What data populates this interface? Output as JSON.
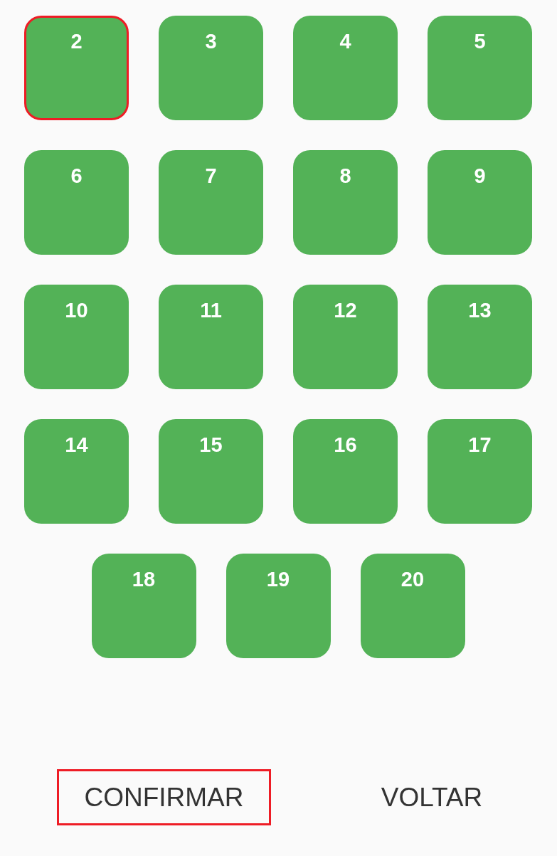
{
  "tiles": [
    {
      "label": "2",
      "selected": true
    },
    {
      "label": "3",
      "selected": false
    },
    {
      "label": "4",
      "selected": false
    },
    {
      "label": "5",
      "selected": false
    },
    {
      "label": "6",
      "selected": false
    },
    {
      "label": "7",
      "selected": false
    },
    {
      "label": "8",
      "selected": false
    },
    {
      "label": "9",
      "selected": false
    },
    {
      "label": "10",
      "selected": false
    },
    {
      "label": "11",
      "selected": false
    },
    {
      "label": "12",
      "selected": false
    },
    {
      "label": "13",
      "selected": false
    },
    {
      "label": "14",
      "selected": false
    },
    {
      "label": "15",
      "selected": false
    },
    {
      "label": "16",
      "selected": false
    },
    {
      "label": "17",
      "selected": false
    },
    {
      "label": "18",
      "selected": false
    },
    {
      "label": "19",
      "selected": false
    },
    {
      "label": "20",
      "selected": false
    }
  ],
  "buttons": [
    {
      "label": "CONFIRMAR",
      "selected": true
    },
    {
      "label": "VOLTAR",
      "selected": false
    }
  ]
}
